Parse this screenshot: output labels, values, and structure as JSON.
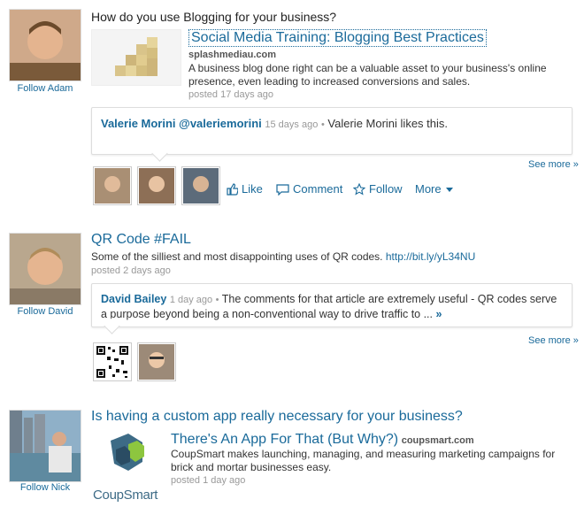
{
  "feed": [
    {
      "follow_label": "Follow Adam",
      "question": "How do you use Blogging for your business?",
      "article_title": "Social Media Training: Blogging Best Practices",
      "source": "splashmediau.com",
      "summary": "A business blog done right can be a valuable asset to your business's online presence, even leading to increased conversions and sales.",
      "posted": "posted 17 days ago",
      "comment": {
        "author": "Valerie Morini @valeriemorini",
        "time": "15 days ago",
        "text": "Valerie Morini likes this."
      },
      "see_more": "See more »",
      "actions": {
        "like": "Like",
        "comment": "Comment",
        "follow": "Follow",
        "more": "More"
      }
    },
    {
      "follow_label": "Follow David",
      "title": "QR Code #FAIL",
      "summary": "Some of the silliest and most disappointing uses of QR codes.",
      "url": "http://bit.ly/yL34NU",
      "posted": "posted 2 days ago",
      "comment": {
        "author": "David Bailey",
        "time": "1 day ago",
        "text": "The comments for that article are extremely useful - QR codes serve a purpose beyond being a non-conventional way to drive traffic to ...",
        "expand": "»"
      },
      "see_more": "See more »"
    },
    {
      "follow_label": "Follow Nick",
      "title": "Is having a custom app really necessary for your business?",
      "article_title": "There's An App For That (But Why?)",
      "source": "coupsmart.com",
      "summary": "CoupSmart makes launching, managing, and measuring marketing campaigns for brick and mortar businesses easy.",
      "posted": "posted 1 day ago",
      "logo_text": "CoupSmart"
    }
  ],
  "icons": {
    "like": "thumbs-up-icon",
    "comment": "speech-bubble-icon",
    "follow": "star-icon",
    "more": "caret-down-icon"
  }
}
